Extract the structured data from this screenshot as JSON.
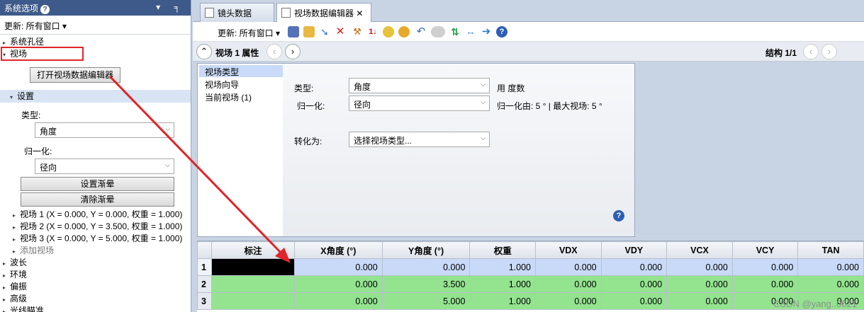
{
  "left_panel": {
    "title": "系统选项",
    "help": "?",
    "controls": "▾ ╕",
    "update": "更新: 所有窗口 ▾",
    "tree": [
      {
        "label": "系统孔径",
        "arrow": "▸"
      },
      {
        "label": "视场",
        "arrow": "▾"
      }
    ],
    "open_button": "打开视场数据编辑器",
    "settings": "设置",
    "type_label": "类型:",
    "type_value": "角度",
    "norm_label": "归一化:",
    "norm_value": "径向",
    "vignette_set": "设置渐晕",
    "vignette_clear": "清除渐晕",
    "fields": [
      "视场 1 (X = 0.000, Y = 0.000, 权重 = 1.000)",
      "视场 2 (X = 0.000, Y = 3.500, 权重 = 1.000)",
      "视场 3 (X = 0.000, Y = 5.000, 权重 = 1.000)"
    ],
    "add_field": "添加视场",
    "groups": [
      "波长",
      "环境",
      "偏振",
      "高级",
      "光线瞄准"
    ]
  },
  "tabs": [
    {
      "label": "镜头数据"
    },
    {
      "label": "视场数据编辑器",
      "close": "✕"
    }
  ],
  "toolbar": {
    "update": "更新: 所有窗口 ▾"
  },
  "nav": {
    "title": "视场  1 属性",
    "structure": "结构 1/1"
  },
  "editor": {
    "list": [
      "视场类型",
      "视场向导",
      "当前视场 (1)"
    ],
    "type_label": "类型:",
    "type_value": "角度",
    "unit_text": "用 度数",
    "norm_label": "归一化:",
    "norm_value": "径向",
    "norm_info": "归一化由: 5 ° | 最大视场: 5 °",
    "convert_label": "转化为:",
    "convert_value": "选择视场类型...",
    "help": "?"
  },
  "grid": {
    "headers": [
      "",
      "标注",
      "X角度 (°)",
      "Y角度 (°)",
      "权重",
      "VDX",
      "VDY",
      "VCX",
      "VCY",
      "TAN"
    ],
    "rows": [
      [
        "1",
        "",
        "0.000",
        "0.000",
        "1.000",
        "0.000",
        "0.000",
        "0.000",
        "0.000",
        "0.000"
      ],
      [
        "2",
        "",
        "0.000",
        "3.500",
        "1.000",
        "0.000",
        "0.000",
        "0.000",
        "0.000",
        "0.000"
      ],
      [
        "3",
        "",
        "0.000",
        "5.000",
        "1.000",
        "0.000",
        "0.000",
        "0.000",
        "0.000",
        "0.000"
      ]
    ]
  },
  "watermark": "CSDN @yang..0021",
  "colors": {
    "arrow": "#e0252a",
    "highlight_row": "#c8daf7",
    "green_rows": "#93e38f",
    "title_bar": "#3e5a8a"
  }
}
